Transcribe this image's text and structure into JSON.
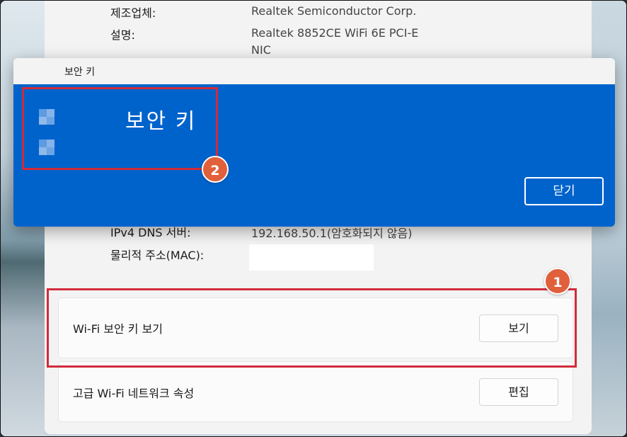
{
  "adapter_info": {
    "manufacturer_label": "제조업체:",
    "manufacturer_value": "Realtek Semiconductor Corp.",
    "description_label": "설명:",
    "description_value_line1": "Realtek 8852CE WiFi 6E PCI-E",
    "description_value_line2": "NIC",
    "dns_label": "IPv4 DNS 서버:",
    "dns_value": "192.168.50.1(암호화되지 않음)",
    "mac_label": "물리적 주소(MAC):"
  },
  "cards": {
    "security_key_label": "Wi-Fi 보안 키 보기",
    "security_key_button": "보기",
    "advanced_label": "고급 Wi-Fi 네트워크 속성",
    "advanced_button": "편집"
  },
  "dialog": {
    "title": "보안 키",
    "heading": "보안 키",
    "close_button": "닫기"
  },
  "annotations": {
    "badge1": "1",
    "badge2": "2"
  },
  "colors": {
    "dialog_blue": "#0063cc",
    "highlight_red": "#d12b3a",
    "badge_orange": "#e0603b"
  }
}
